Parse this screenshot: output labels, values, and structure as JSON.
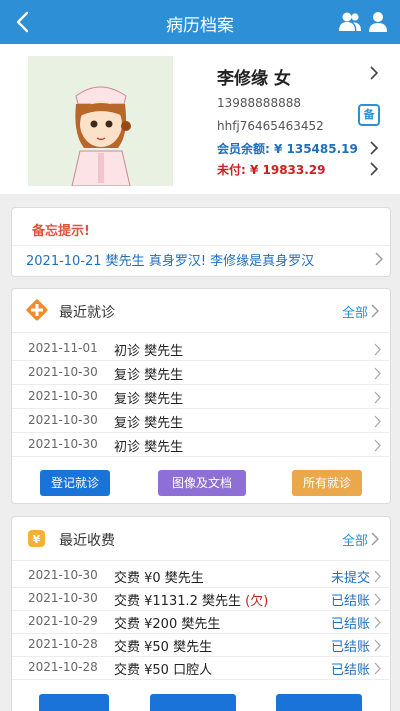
{
  "header": {
    "title": "病历档案",
    "colors": {
      "bar": "#2d8fd5"
    }
  },
  "patient": {
    "name": "李修缘 女",
    "phone": "13988888888",
    "code": "hhfj76465463452",
    "memo_badge": "备",
    "balance_label": "会员余额: ¥ 135485.19",
    "unpaid_label": "未付: ¥ 19833.29"
  },
  "memo": {
    "title": "备忘提示!",
    "text": "2021-10-21  樊先生  真身罗汉!    李修缘是真身罗汉"
  },
  "visits": {
    "title": "最近就诊",
    "all_label": "全部",
    "rows": [
      {
        "date": "2021-11-01",
        "type": "初诊",
        "doctor": "樊先生"
      },
      {
        "date": "2021-10-30",
        "type": "复诊",
        "doctor": "樊先生"
      },
      {
        "date": "2021-10-30",
        "type": "复诊",
        "doctor": "樊先生"
      },
      {
        "date": "2021-10-30",
        "type": "复诊",
        "doctor": "樊先生"
      },
      {
        "date": "2021-10-30",
        "type": "初诊",
        "doctor": "樊先生"
      }
    ],
    "buttons": {
      "register": "登记就诊",
      "images": "图像及文档",
      "all_visits": "所有就诊"
    }
  },
  "fees": {
    "title": "最近收费",
    "all_label": "全部",
    "rows": [
      {
        "date": "2021-10-30",
        "desc": "交费 ¥0 樊先生",
        "owe": "",
        "status": "未提交"
      },
      {
        "date": "2021-10-30",
        "desc": "交费 ¥1131.2 樊先生",
        "owe": "(欠)",
        "status": "已结账"
      },
      {
        "date": "2021-10-29",
        "desc": "交费 ¥200 樊先生",
        "owe": "",
        "status": "已结账"
      },
      {
        "date": "2021-10-28",
        "desc": "交费 ¥50 樊先生",
        "owe": "",
        "status": "已结账"
      },
      {
        "date": "2021-10-28",
        "desc": "交费 ¥50 口腔人",
        "owe": "",
        "status": "已结账"
      }
    ]
  }
}
